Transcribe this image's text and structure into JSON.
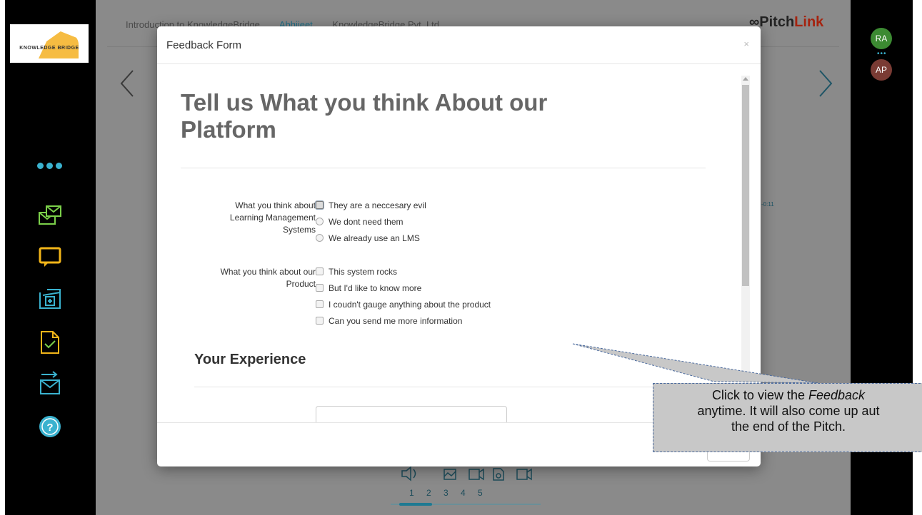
{
  "logo": {
    "text": "KNOWLEDGE BRIDGE"
  },
  "top_tabs": [
    "Introduction to KnowledgeBridge",
    "Abhijeet",
    "KnowledgeBridge Pvt. Ltd."
  ],
  "brand": {
    "pitch": "Pitch",
    "link": "Link"
  },
  "avatars": [
    {
      "initials": "RA",
      "color": "#3c8a32"
    },
    {
      "initials": "AP",
      "color": "#7a3b34"
    }
  ],
  "left_toolbar": [
    "menu-dots-icon",
    "share-email-icon",
    "chat-icon",
    "add-folder-icon",
    "document-check-icon",
    "forward-email-icon",
    "help-icon"
  ],
  "stage": {
    "time_label": "-0:11",
    "slide_numbers": "1 2 3 4 5",
    "progress": 0.22
  },
  "modal": {
    "title": "Feedback Form",
    "close": "×",
    "heading": "Tell us What you think About our Platform",
    "q1": {
      "label": "What you think about Learning Management Systems",
      "options": [
        "They are a neccesary evil",
        "We dont need them",
        "We already use an LMS"
      ]
    },
    "q2": {
      "label": "What you think about our Product",
      "options": [
        "This system rocks",
        "But I'd like to know more",
        "I coudn't gauge anything about the product",
        "Can you send me more information"
      ]
    },
    "section_title": "Your Experience"
  },
  "tooltip": {
    "line1_prefix": "Click to view the ",
    "line1_em": "Feedback",
    "line2": "anytime. It will also come up aut",
    "line3": "the end of the Pitch."
  }
}
